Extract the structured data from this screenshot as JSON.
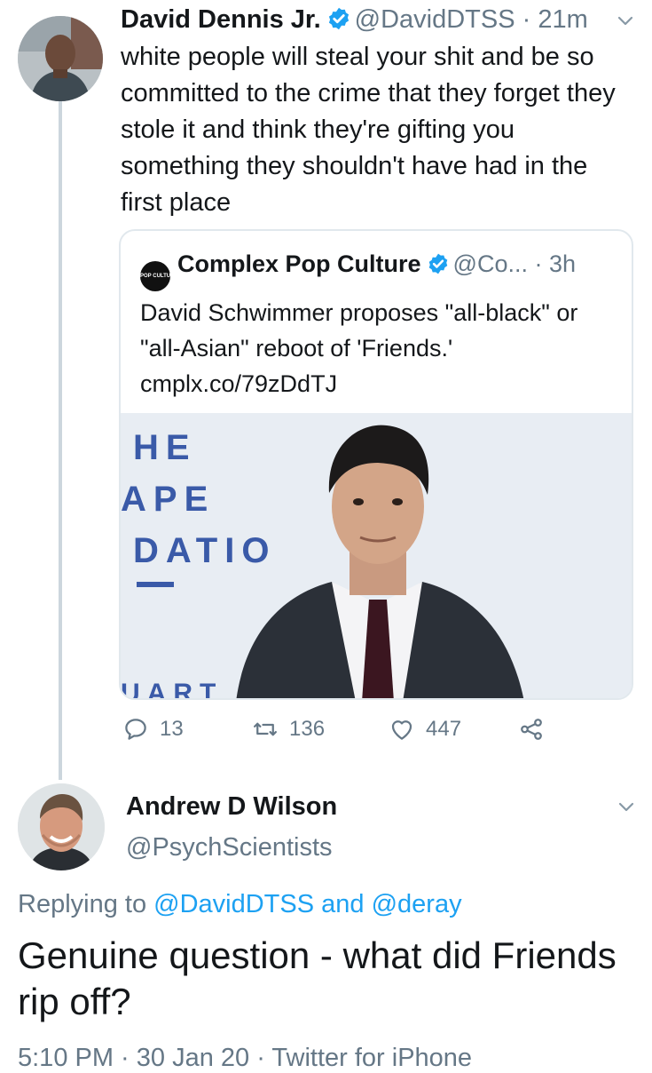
{
  "tweet1": {
    "name": "David Dennis Jr.",
    "handle": "@DavidDTSS",
    "separator": " · ",
    "time": "21m",
    "text": "white people will steal your shit and be so committed to the crime that they forget they stole it and think they're gifting you something they shouldn't have had in the first place"
  },
  "quote": {
    "logo_text": "POP CULTURE",
    "name": "Complex Pop Culture",
    "handle": "@Co...",
    "separator": " · ",
    "time": "3h",
    "text": "David Schwimmer proposes \"all-black\" or \"all-Asian\" reboot of 'Friends.'",
    "link": "cmplx.co/79zDdTJ",
    "image_backdrop_text": [
      "HE",
      "APE",
      "DATIO",
      "UART"
    ]
  },
  "actions": {
    "replies": "13",
    "retweets": "136",
    "likes": "447"
  },
  "tweet2": {
    "name": "Andrew D Wilson",
    "handle": "@PsychScientists",
    "replying_prefix": "Replying to ",
    "replying_user1": "@DavidDTSS",
    "replying_and": " and ",
    "replying_user2": "@deray",
    "text": "Genuine question - what did Friends rip off?",
    "timestamp": "5:10 PM · 30 Jan 20 · Twitter for iPhone"
  },
  "colors": {
    "accent": "#1da1f2",
    "muted": "#657786",
    "border": "#e1e8ed"
  }
}
